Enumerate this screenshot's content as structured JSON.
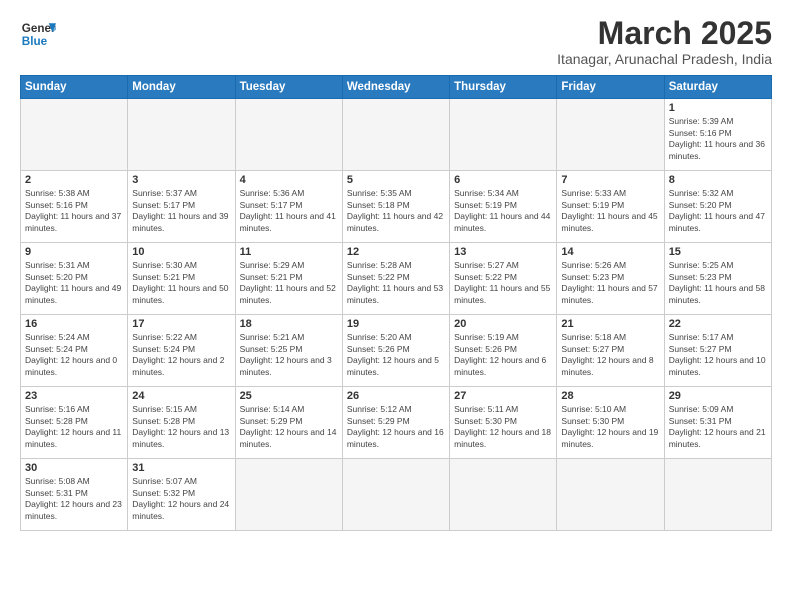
{
  "header": {
    "logo_general": "General",
    "logo_blue": "Blue",
    "month_title": "March 2025",
    "subtitle": "Itanagar, Arunachal Pradesh, India"
  },
  "weekdays": [
    "Sunday",
    "Monday",
    "Tuesday",
    "Wednesday",
    "Thursday",
    "Friday",
    "Saturday"
  ],
  "days": [
    {
      "num": "",
      "info": ""
    },
    {
      "num": "",
      "info": ""
    },
    {
      "num": "",
      "info": ""
    },
    {
      "num": "",
      "info": ""
    },
    {
      "num": "",
      "info": ""
    },
    {
      "num": "",
      "info": ""
    },
    {
      "num": "1",
      "info": "Sunrise: 5:39 AM\nSunset: 5:16 PM\nDaylight: 11 hours and 36 minutes."
    },
    {
      "num": "2",
      "info": "Sunrise: 5:38 AM\nSunset: 5:16 PM\nDaylight: 11 hours and 37 minutes."
    },
    {
      "num": "3",
      "info": "Sunrise: 5:37 AM\nSunset: 5:17 PM\nDaylight: 11 hours and 39 minutes."
    },
    {
      "num": "4",
      "info": "Sunrise: 5:36 AM\nSunset: 5:17 PM\nDaylight: 11 hours and 41 minutes."
    },
    {
      "num": "5",
      "info": "Sunrise: 5:35 AM\nSunset: 5:18 PM\nDaylight: 11 hours and 42 minutes."
    },
    {
      "num": "6",
      "info": "Sunrise: 5:34 AM\nSunset: 5:19 PM\nDaylight: 11 hours and 44 minutes."
    },
    {
      "num": "7",
      "info": "Sunrise: 5:33 AM\nSunset: 5:19 PM\nDaylight: 11 hours and 45 minutes."
    },
    {
      "num": "8",
      "info": "Sunrise: 5:32 AM\nSunset: 5:20 PM\nDaylight: 11 hours and 47 minutes."
    },
    {
      "num": "9",
      "info": "Sunrise: 5:31 AM\nSunset: 5:20 PM\nDaylight: 11 hours and 49 minutes."
    },
    {
      "num": "10",
      "info": "Sunrise: 5:30 AM\nSunset: 5:21 PM\nDaylight: 11 hours and 50 minutes."
    },
    {
      "num": "11",
      "info": "Sunrise: 5:29 AM\nSunset: 5:21 PM\nDaylight: 11 hours and 52 minutes."
    },
    {
      "num": "12",
      "info": "Sunrise: 5:28 AM\nSunset: 5:22 PM\nDaylight: 11 hours and 53 minutes."
    },
    {
      "num": "13",
      "info": "Sunrise: 5:27 AM\nSunset: 5:22 PM\nDaylight: 11 hours and 55 minutes."
    },
    {
      "num": "14",
      "info": "Sunrise: 5:26 AM\nSunset: 5:23 PM\nDaylight: 11 hours and 57 minutes."
    },
    {
      "num": "15",
      "info": "Sunrise: 5:25 AM\nSunset: 5:23 PM\nDaylight: 11 hours and 58 minutes."
    },
    {
      "num": "16",
      "info": "Sunrise: 5:24 AM\nSunset: 5:24 PM\nDaylight: 12 hours and 0 minutes."
    },
    {
      "num": "17",
      "info": "Sunrise: 5:22 AM\nSunset: 5:24 PM\nDaylight: 12 hours and 2 minutes."
    },
    {
      "num": "18",
      "info": "Sunrise: 5:21 AM\nSunset: 5:25 PM\nDaylight: 12 hours and 3 minutes."
    },
    {
      "num": "19",
      "info": "Sunrise: 5:20 AM\nSunset: 5:26 PM\nDaylight: 12 hours and 5 minutes."
    },
    {
      "num": "20",
      "info": "Sunrise: 5:19 AM\nSunset: 5:26 PM\nDaylight: 12 hours and 6 minutes."
    },
    {
      "num": "21",
      "info": "Sunrise: 5:18 AM\nSunset: 5:27 PM\nDaylight: 12 hours and 8 minutes."
    },
    {
      "num": "22",
      "info": "Sunrise: 5:17 AM\nSunset: 5:27 PM\nDaylight: 12 hours and 10 minutes."
    },
    {
      "num": "23",
      "info": "Sunrise: 5:16 AM\nSunset: 5:28 PM\nDaylight: 12 hours and 11 minutes."
    },
    {
      "num": "24",
      "info": "Sunrise: 5:15 AM\nSunset: 5:28 PM\nDaylight: 12 hours and 13 minutes."
    },
    {
      "num": "25",
      "info": "Sunrise: 5:14 AM\nSunset: 5:29 PM\nDaylight: 12 hours and 14 minutes."
    },
    {
      "num": "26",
      "info": "Sunrise: 5:12 AM\nSunset: 5:29 PM\nDaylight: 12 hours and 16 minutes."
    },
    {
      "num": "27",
      "info": "Sunrise: 5:11 AM\nSunset: 5:30 PM\nDaylight: 12 hours and 18 minutes."
    },
    {
      "num": "28",
      "info": "Sunrise: 5:10 AM\nSunset: 5:30 PM\nDaylight: 12 hours and 19 minutes."
    },
    {
      "num": "29",
      "info": "Sunrise: 5:09 AM\nSunset: 5:31 PM\nDaylight: 12 hours and 21 minutes."
    },
    {
      "num": "30",
      "info": "Sunrise: 5:08 AM\nSunset: 5:31 PM\nDaylight: 12 hours and 23 minutes."
    },
    {
      "num": "31",
      "info": "Sunrise: 5:07 AM\nSunset: 5:32 PM\nDaylight: 12 hours and 24 minutes."
    },
    {
      "num": "",
      "info": ""
    },
    {
      "num": "",
      "info": ""
    },
    {
      "num": "",
      "info": ""
    },
    {
      "num": "",
      "info": ""
    },
    {
      "num": "",
      "info": ""
    }
  ]
}
